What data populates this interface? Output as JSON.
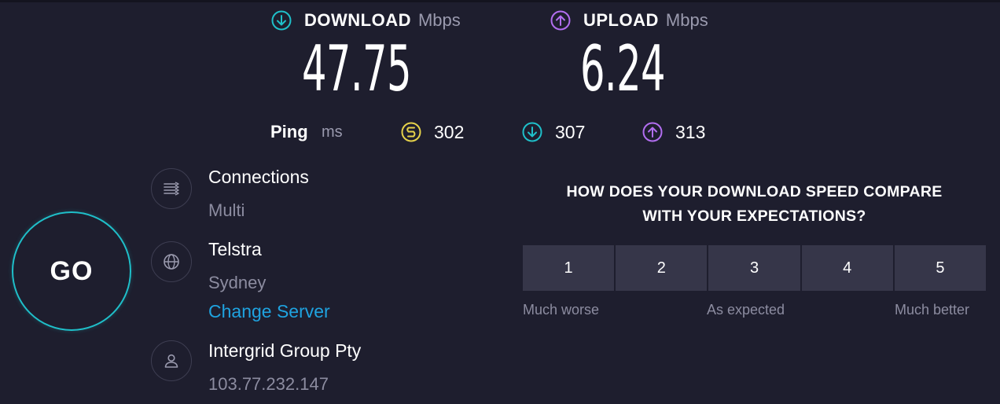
{
  "download": {
    "title": "DOWNLOAD",
    "unit": "Mbps",
    "value": "47.75",
    "icon": "arrow-down-circle-icon",
    "color": "#1fbfc9"
  },
  "upload": {
    "title": "UPLOAD",
    "unit": "Mbps",
    "value": "6.24",
    "icon": "arrow-up-circle-icon",
    "color": "#b26ef0"
  },
  "ping": {
    "label": "Ping",
    "unit": "ms",
    "idle": {
      "value": "302",
      "icon": "idle-ping-icon",
      "color": "#e6d24a"
    },
    "download": {
      "value": "307",
      "icon": "arrow-down-circle-icon",
      "color": "#1fbfc9"
    },
    "upload": {
      "value": "313",
      "icon": "arrow-up-circle-icon",
      "color": "#b26ef0"
    }
  },
  "go": {
    "label": "GO",
    "color": "#1fbfc9"
  },
  "connections": {
    "title": "Connections",
    "value": "Multi",
    "icon": "connections-icon"
  },
  "server": {
    "title": "Telstra",
    "location": "Sydney",
    "change_label": "Change Server",
    "icon": "globe-icon"
  },
  "provider": {
    "title": "Intergrid Group Pty",
    "ip": "103.77.232.147",
    "icon": "user-icon"
  },
  "survey": {
    "question_line1": "HOW DOES YOUR DOWNLOAD SPEED COMPARE",
    "question_line2": "WITH YOUR EXPECTATIONS?",
    "ratings": [
      "1",
      "2",
      "3",
      "4",
      "5"
    ],
    "label_low": "Much worse",
    "label_mid": "As expected",
    "label_high": "Much better"
  }
}
